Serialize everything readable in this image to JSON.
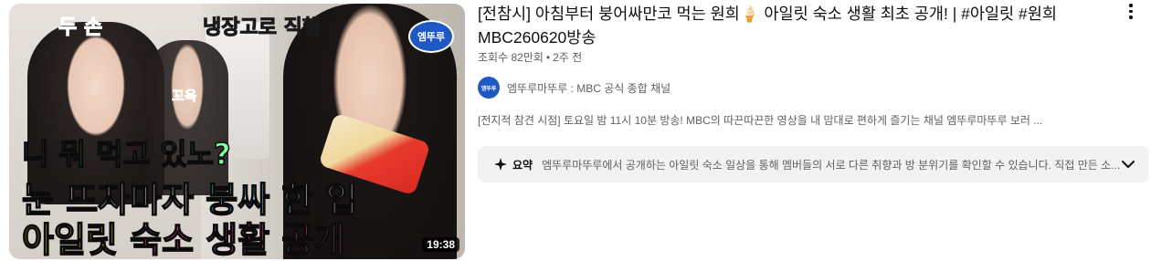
{
  "video": {
    "duration": "19:38",
    "thumbnail": {
      "text_top_left": "두 손",
      "text_top_right": "냉장고로 직행",
      "text_small": "꼬옥",
      "line1": "니 뭐 먹고 있노?",
      "line2_a": "눈 뜨자마자 ",
      "line2_b": "붕싸",
      "line2_c": " 한 입",
      "line3_a": "아일릿 ",
      "line3_b": "숙소 생활 공개",
      "logo_text": "엠뚜루"
    },
    "title": "[전참시] 아침부터 붕어싸만코 먹는 원희🍦 아일릿 숙소 생활 최초 공개! | #아일릿 #원희 MBC260620방송",
    "views": "조회수 82만회",
    "age": "2주 전"
  },
  "channel": {
    "avatar_text": "엠뚜루",
    "name": "엠뚜루마뚜루 : MBC 공식 종합 채널"
  },
  "description": "[전지적 참견 시점] 토요일 밤 11시 10분 방송! MBC의 따끈따끈한 영상을 내 맘대로 편하게 즐기는 채널 엠뚜루마뚜루 보러 ...",
  "summary": {
    "label": "요약",
    "text": "엠뚜루마뚜루에서 공개하는 아일릿 숙소 일상을 통해 멤버들의 서로 다른 취향과 방 분위기를 확인할 수 있습니다. 직접 만든 소..."
  },
  "icons": {
    "spark": "sparkle-icon",
    "chevron": "chevron-down-icon",
    "menu": "more-vert-icon"
  }
}
